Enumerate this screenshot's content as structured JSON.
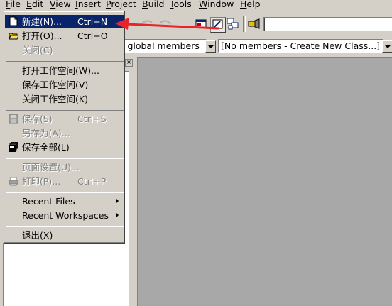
{
  "menubar": {
    "items": [
      "File",
      "Edit",
      "View",
      "Insert",
      "Project",
      "Build",
      "Tools",
      "Window",
      "Help"
    ],
    "mnemonics": [
      "F",
      "E",
      "V",
      "I",
      "P",
      "B",
      "T",
      "W",
      "H"
    ]
  },
  "toolbar": {
    "members_combo": "l global members",
    "class_combo": "[No members - Create New Class...]"
  },
  "file_menu": {
    "items": [
      {
        "label": "新建(N)...",
        "shortcut": "Ctrl+N",
        "state": "highlight",
        "icon": "new-file-icon"
      },
      {
        "label": "打开(O)...",
        "shortcut": "Ctrl+O",
        "state": "enabled",
        "icon": "open-folder-icon"
      },
      {
        "label": "关闭(C)",
        "shortcut": "",
        "state": "disabled"
      },
      {
        "label": "打开工作空间(W)...",
        "shortcut": "",
        "state": "enabled"
      },
      {
        "label": "保存工作空间(V)",
        "shortcut": "",
        "state": "enabled"
      },
      {
        "label": "关闭工作空间(K)",
        "shortcut": "",
        "state": "enabled"
      },
      {
        "label": "保存(S)",
        "shortcut": "Ctrl+S",
        "state": "disabled",
        "icon": "save-disk-icon"
      },
      {
        "label": "另存为(A)...",
        "shortcut": "",
        "state": "disabled"
      },
      {
        "label": "保存全部(L)",
        "shortcut": "",
        "state": "enabled",
        "icon": "save-all-icon"
      },
      {
        "label": "页面设置(U)...",
        "shortcut": "",
        "state": "disabled"
      },
      {
        "label": "打印(P)...",
        "shortcut": "Ctrl+P",
        "state": "disabled",
        "icon": "print-icon"
      },
      {
        "label": "Recent Files",
        "shortcut": "",
        "state": "enabled",
        "submenu": true
      },
      {
        "label": "Recent Workspaces",
        "shortcut": "",
        "state": "enabled",
        "submenu": true
      },
      {
        "label": "退出(X)",
        "shortcut": "",
        "state": "enabled"
      }
    ]
  },
  "colors": {
    "face": "#d4d0c8",
    "highlight": "#0a246a",
    "mdi_background": "#a8a8a8",
    "arrow": "#e8242a"
  }
}
